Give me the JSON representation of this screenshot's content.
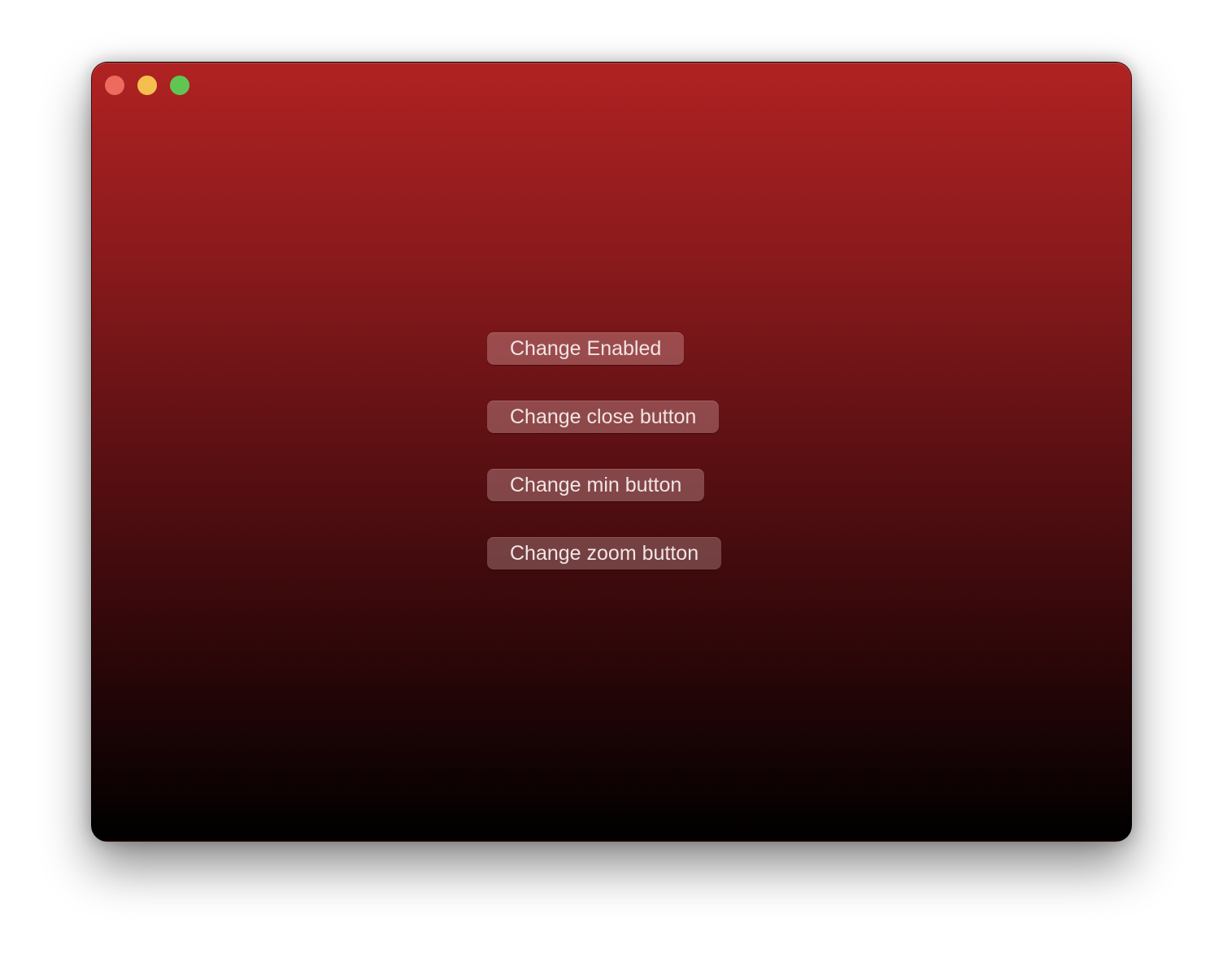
{
  "window": {
    "traffic_lights": {
      "close": {
        "color": "#ec6a5e"
      },
      "minimize": {
        "color": "#f4bf4f"
      },
      "zoom": {
        "color": "#61c554"
      }
    },
    "background_gradient": [
      "#b02222",
      "#000000"
    ]
  },
  "buttons": [
    {
      "label": "Change Enabled"
    },
    {
      "label": "Change close button"
    },
    {
      "label": "Change min button"
    },
    {
      "label": "Change zoom button"
    }
  ]
}
